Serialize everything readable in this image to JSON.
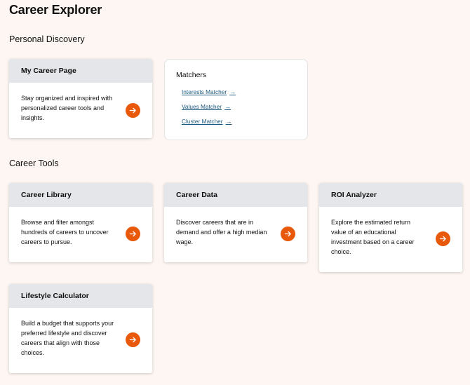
{
  "page": {
    "title": "Career Explorer"
  },
  "sections": {
    "personal_discovery": "Personal Discovery",
    "career_tools": "Career Tools"
  },
  "my_career_page": {
    "title": "My Career Page",
    "description": "Stay organized and inspired with personalized career tools and insights."
  },
  "matchers": {
    "title": "Matchers",
    "links": [
      {
        "label": "Interests Matcher"
      },
      {
        "label": "Values Matcher"
      },
      {
        "label": "Cluster Matcher"
      }
    ]
  },
  "tools": [
    {
      "title": "Career Library",
      "description": "Browse and filter amongst hundreds of careers to uncover careers to pursue."
    },
    {
      "title": "Career Data",
      "description": "Discover careers that are in demand and offer a high median wage."
    },
    {
      "title": "ROI Analyzer",
      "description": "Explore the estimated return value of an educational investment based on a career choice."
    },
    {
      "title": "Lifestyle Calculator",
      "description": "Build a budget that supports your preferred lifestyle and discover careers that align with those choices."
    }
  ],
  "colors": {
    "background": "#fdf6f2",
    "card_header": "#e5e6e9",
    "accent": "#e8590c",
    "link": "#1d5a7f"
  },
  "icons": {
    "card_action": "arrow-right-icon",
    "link_arrow": "arrow-right-icon"
  }
}
